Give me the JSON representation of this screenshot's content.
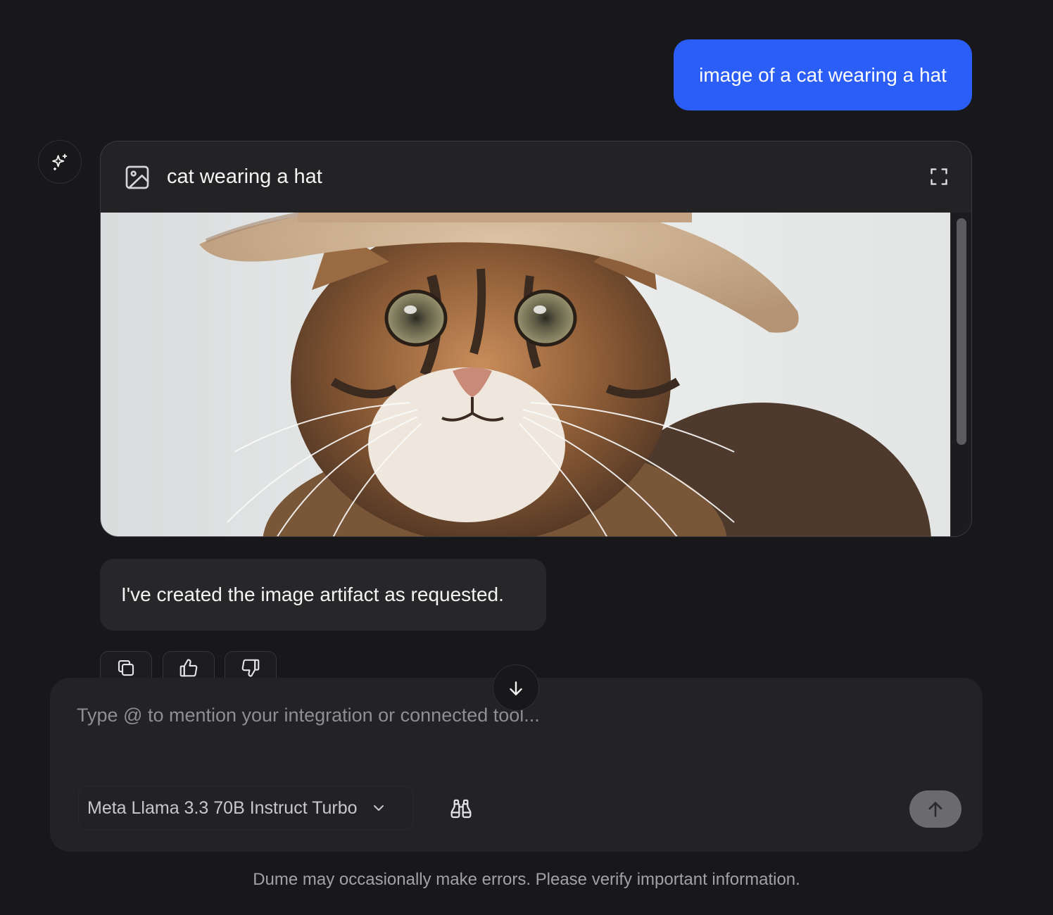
{
  "user_message": "image of a cat wearing a hat",
  "artifact": {
    "title": "cat wearing a hat",
    "type_icon": "image-icon",
    "expand_icon": "expand-icon",
    "image_subject": "tabby cat wearing a straw sun hat"
  },
  "assistant_message": "I've created the image artifact as requested.",
  "message_actions": [
    {
      "name": "copy",
      "icon": "copy-icon"
    },
    {
      "name": "thumbs-up",
      "icon": "thumbs-up-icon"
    },
    {
      "name": "thumbs-down",
      "icon": "thumbs-down-icon"
    }
  ],
  "composer": {
    "placeholder": "Type @ to mention your integration or connected tool...",
    "model": "Meta Llama 3.3 70B Instruct Turbo",
    "research_icon": "binoculars-icon",
    "send_icon": "arrow-up-icon"
  },
  "scroll_down_icon": "arrow-down-icon",
  "disclaimer": "Dume may occasionally make errors. Please verify important information.",
  "colors": {
    "background": "#18181b",
    "user_bubble": "#2b5ef6",
    "panel": "#232325",
    "send_button": "#6b6b6e"
  }
}
